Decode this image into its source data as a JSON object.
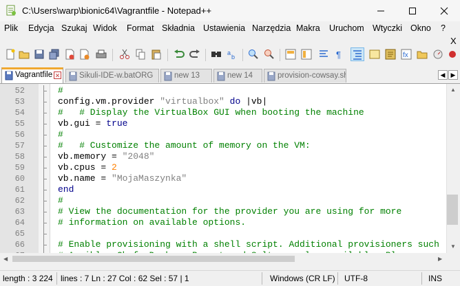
{
  "window": {
    "title": "C:\\Users\\warp\\bionic64\\Vagrantfile - Notepad++",
    "minimize_icon": "minimize-icon",
    "maximize_icon": "maximize-icon",
    "close_icon": "close-icon"
  },
  "menu": {
    "items": [
      "Plik",
      "Edycja",
      "Szukaj",
      "Widok",
      "Format",
      "Składnia",
      "Ustawienia",
      "Narzędzia",
      "Makra",
      "Uruchom",
      "Wtyczki",
      "Okno",
      "?"
    ],
    "close_label": "X"
  },
  "toolbar": {
    "icons": [
      "new-file-icon",
      "open-file-icon",
      "save-icon",
      "save-all-icon",
      "close-icon",
      "close-all-icon",
      "print-icon",
      "cut-icon",
      "copy-icon",
      "paste-icon",
      "undo-icon",
      "redo-icon",
      "find-icon",
      "replace-icon",
      "zoom-in-icon",
      "zoom-out-icon",
      "sync-vertical-icon",
      "sync-horizontal-icon",
      "word-wrap-icon",
      "show-all-chars-icon",
      "indent-guide-icon",
      "udl-icon",
      "doc-map-icon",
      "function-list-icon",
      "folder-workspace-icon",
      "monitoring-icon",
      "record-macro-icon"
    ]
  },
  "tabs": [
    {
      "label": "Vagrantfile",
      "active": true
    },
    {
      "label": "Sikuli-IDE-w.batORG",
      "active": false
    },
    {
      "label": "new 13",
      "active": false
    },
    {
      "label": "new 14",
      "active": false
    },
    {
      "label": "provision-cowsay.sh",
      "active": false
    }
  ],
  "editor": {
    "lines": [
      {
        "num": "52",
        "segments": [
          {
            "t": "#",
            "c": "comment"
          }
        ]
      },
      {
        "num": "53",
        "segments": [
          {
            "t": "config.vm.provider ",
            "c": "normal"
          },
          {
            "t": "\"virtualbox\"",
            "c": "string"
          },
          {
            "t": " ",
            "c": "normal"
          },
          {
            "t": "do",
            "c": "kw"
          },
          {
            "t": " |vb|",
            "c": "normal"
          }
        ]
      },
      {
        "num": "54",
        "segments": [
          {
            "t": "#   # Display the VirtualBox GUI when booting the machine",
            "c": "comment"
          }
        ]
      },
      {
        "num": "55",
        "segments": [
          {
            "t": "vb.gui = ",
            "c": "normal"
          },
          {
            "t": "true",
            "c": "kw"
          }
        ]
      },
      {
        "num": "56",
        "segments": [
          {
            "t": "#",
            "c": "comment"
          }
        ]
      },
      {
        "num": "57",
        "segments": [
          {
            "t": "#   # Customize the amount of memory on the VM:",
            "c": "comment"
          }
        ]
      },
      {
        "num": "58",
        "segments": [
          {
            "t": "vb.memory = ",
            "c": "normal"
          },
          {
            "t": "\"2048\"",
            "c": "string"
          }
        ]
      },
      {
        "num": "59",
        "segments": [
          {
            "t": "vb.cpus = ",
            "c": "normal"
          },
          {
            "t": "2",
            "c": "num"
          }
        ]
      },
      {
        "num": "60",
        "segments": [
          {
            "t": "vb.name = ",
            "c": "normal"
          },
          {
            "t": "\"MojaMaszynka\"",
            "c": "string"
          }
        ]
      },
      {
        "num": "61",
        "segments": [
          {
            "t": "end",
            "c": "kw"
          }
        ]
      },
      {
        "num": "62",
        "segments": [
          {
            "t": "#",
            "c": "comment"
          }
        ]
      },
      {
        "num": "63",
        "segments": [
          {
            "t": "# View the documentation for the provider you are using for more",
            "c": "comment"
          }
        ]
      },
      {
        "num": "64",
        "segments": [
          {
            "t": "# information on available options.",
            "c": "comment"
          }
        ]
      },
      {
        "num": "65",
        "segments": [
          {
            "t": "",
            "c": "normal"
          }
        ]
      },
      {
        "num": "66",
        "segments": [
          {
            "t": "# Enable provisioning with a shell script. Additional provisioners such",
            "c": "comment"
          }
        ]
      },
      {
        "num": "67",
        "segments": [
          {
            "t": "# Ansible, Chef, Docker, Puppet and Salt are also available. Please se",
            "c": "comment"
          }
        ]
      }
    ]
  },
  "status": {
    "length": "length : 3 224",
    "position": "lines : 7 Ln : 27    Col : 62    Sel : 57 | 1",
    "eol": "Windows (CR LF)",
    "encoding": "UTF-8",
    "mode": "INS"
  },
  "colors": {
    "comment": "#008000",
    "string": "#808080",
    "keyword": "#00008b",
    "number": "#ff8000",
    "active_tab_accent": "#f0a830"
  }
}
